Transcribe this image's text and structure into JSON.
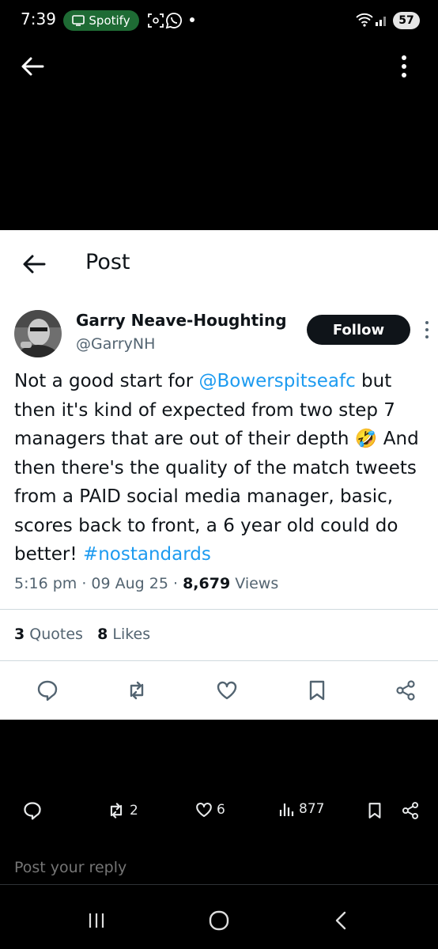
{
  "status_bar": {
    "time": "7:39",
    "spotify_label": "Spotify",
    "battery": "57"
  },
  "header": {
    "title": "Post"
  },
  "tweet": {
    "author_name": "Garry Neave-Houghting",
    "author_handle": "@GarryNH",
    "follow_label": "Follow",
    "text_1": "Not a good start for ",
    "mention": "@Bowerspitseafc",
    "text_2": " but then it's kind of expected from two step 7 managers that are out of their depth 🤣 And then there's the quality of the match tweets from a PAID social media manager, basic, scores back to front, a 6 year old could do better! ",
    "hashtag": "#nostandards",
    "time": "5:16 pm",
    "date": "09 Aug 25",
    "views_count": "8,679",
    "views_label": "Views",
    "quotes_count": "3",
    "quotes_label": "Quotes",
    "likes_count": "8",
    "likes_label": "Likes"
  },
  "bottom_bar": {
    "reposts": "2",
    "likes": "6",
    "views": "877"
  },
  "reply": {
    "placeholder": "Post your reply"
  },
  "colors": {
    "accent": "#1d9bf0",
    "spotify_green": "#1e6b34",
    "secondary_text": "#536471"
  },
  "icons": [
    "back-arrow-icon",
    "more-vertical-icon",
    "reply-icon",
    "repost-icon",
    "like-icon",
    "bookmark-icon",
    "share-icon",
    "views-icon"
  ]
}
